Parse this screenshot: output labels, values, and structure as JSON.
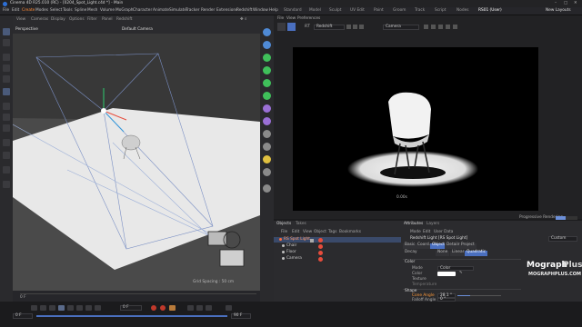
{
  "window": {
    "title": "Cinema 4D R25.010 (RC) - [0204_Spot_Light.c4d *] - Main"
  },
  "menu": {
    "items": [
      "File",
      "Edit",
      "Create",
      "Modes",
      "Select",
      "Tools",
      "Spline",
      "Mesh",
      "Volume",
      "MoGraph",
      "Character",
      "Animate",
      "Simulate",
      "Tracker",
      "Render",
      "Extensions",
      "Redshift",
      "Window",
      "Help"
    ],
    "active": "Create"
  },
  "layouts": {
    "tabs": [
      "Standard",
      "Model",
      "Sculpt",
      "UV Edit",
      "Paint",
      "Groom",
      "Track",
      "Script",
      "Nodes",
      "RS01 (User)"
    ],
    "active": "RS01 (User)",
    "new_layouts": "New Layouts"
  },
  "viewport": {
    "name": "Perspective",
    "camera": "Default Camera",
    "menu": [
      "View",
      "Cameras",
      "Display",
      "Options",
      "Filter",
      "Panel",
      "Redshift"
    ],
    "grid_spacing": "Grid Spacing : 50 cm"
  },
  "renderview": {
    "menu": [
      "File",
      "View",
      "Preferences"
    ],
    "renderer": "Redshift",
    "camera": "Camera",
    "time": "0.00s",
    "progress": "Progressive Rendering",
    "progress_value": 0.45
  },
  "objects": {
    "tabs": [
      "Objects",
      "Takes"
    ],
    "menu": [
      "File",
      "Edit",
      "View",
      "Object",
      "Tags",
      "Bookmarks"
    ],
    "items": [
      {
        "name": "RS Spot Light",
        "color": "#ff6b3a",
        "selected": true
      },
      {
        "name": "Chair",
        "color": "#c0c0c0",
        "selected": false
      },
      {
        "name": "Floor",
        "color": "#c0c0c0",
        "selected": false
      },
      {
        "name": "Camera",
        "color": "#c0c0c0",
        "selected": false
      }
    ]
  },
  "attributes": {
    "tabs": [
      "Attributes",
      "Layers"
    ],
    "menu": [
      "Mode",
      "Edit",
      "User Data"
    ],
    "object_line": "Redshift Light [RS Spot Light]",
    "mode_value": "Custom",
    "subtabs": [
      "Basic",
      "Coord.",
      "Object",
      "Details",
      "Project"
    ],
    "active_subtab": "Object",
    "radio": [
      "Decay",
      "None",
      "Linear",
      "Quadratic"
    ],
    "active_radio": "Quadratic",
    "color_section": "Color",
    "color_rows": [
      {
        "label": "Mode",
        "value": "Color"
      },
      {
        "label": "Color",
        "value": ""
      },
      {
        "label": "Texture",
        "value": ""
      },
      {
        "label": "Temperature",
        "value": ""
      }
    ],
    "shape_section": "Shape",
    "shape_rows": [
      {
        "label": "Cone Angle",
        "value": "28.1 °",
        "highlight": true,
        "fill": 0.3
      },
      {
        "label": "Falloff Angle",
        "value": "0 °",
        "highlight": false,
        "fill": 0.0
      },
      {
        "label": "Falloff Curve",
        "value": "0",
        "highlight": false,
        "fill": 0.0
      }
    ]
  },
  "timeline": {
    "current": "0 F",
    "start": "0 F",
    "end": "90 F",
    "frame_field": "0 F"
  },
  "watermark": {
    "title": "Mograph",
    "title_accent": "Plus",
    "url": "MOGRAPHPLUS.COM"
  },
  "colors": {
    "accent": "#4a6fbf",
    "active_menu": "#ff8a33",
    "highlight_label": "#ff9a3a"
  }
}
